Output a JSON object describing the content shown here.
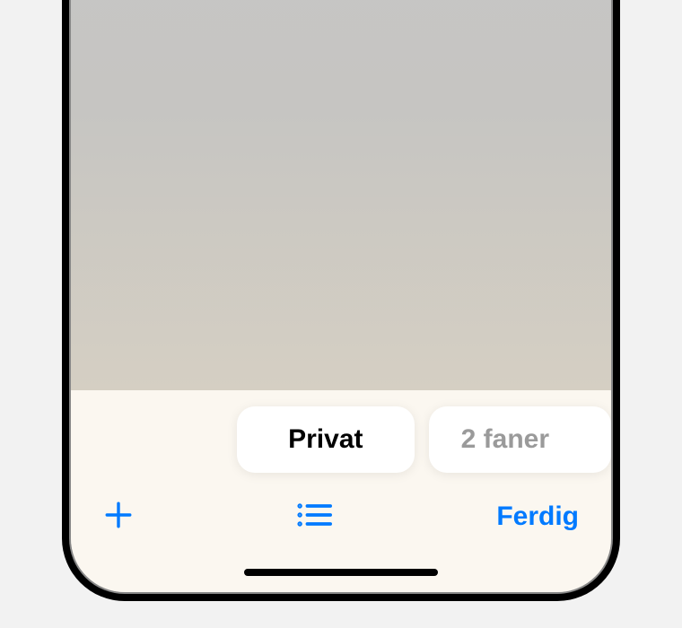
{
  "tab_groups": {
    "active_label": "Privat",
    "secondary_label": "2 faner"
  },
  "toolbar": {
    "done_label": "Ferdig"
  },
  "colors": {
    "accent": "#007aff"
  },
  "icons": {
    "plus": "plus-icon",
    "list": "list-icon"
  }
}
